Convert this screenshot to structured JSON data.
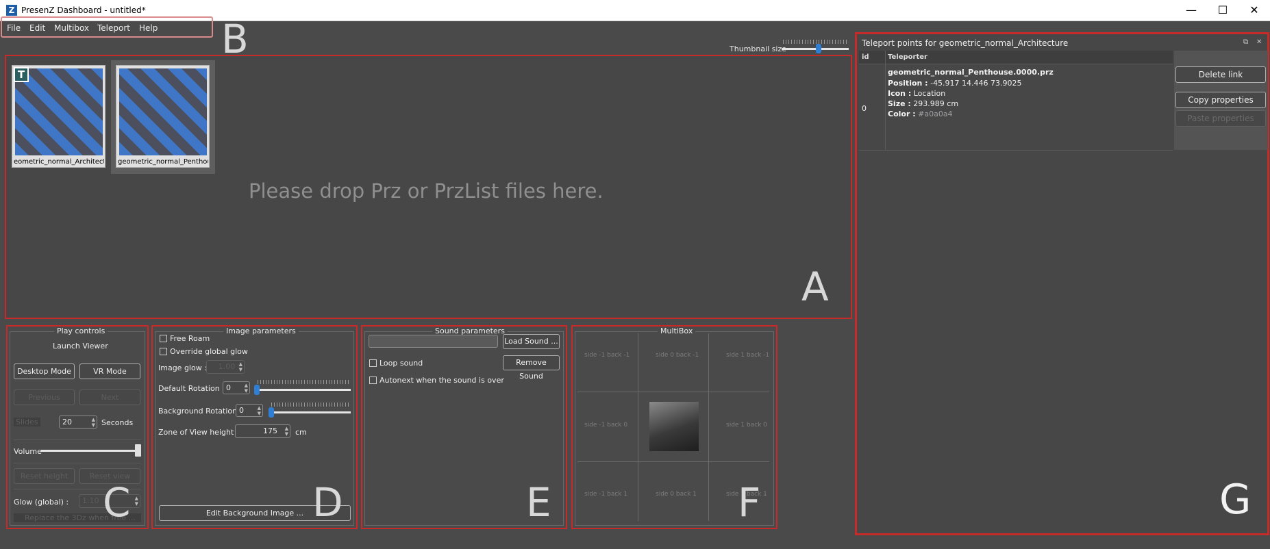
{
  "window": {
    "app_icon": "Z",
    "title": "PresenZ Dashboard - untitled*",
    "minimize": "—",
    "maximize": "☐",
    "close": "✕"
  },
  "menu": [
    "File",
    "Edit",
    "Multibox",
    "Teleport",
    "Help"
  ],
  "region_labels": {
    "a": "A",
    "b": "B",
    "c": "C",
    "d": "D",
    "e": "E",
    "f": "F",
    "g": "G"
  },
  "thumbnails": {
    "size_label": "Thumbnail size",
    "size_value": 0.55,
    "items": [
      {
        "badge": "T",
        "label": "eometric_normal_Architectur"
      },
      {
        "badge": "",
        "label": "geometric_normal_Penthouse"
      }
    ]
  },
  "drop_hint": "Please drop Prz or PrzList files here.",
  "play_controls": {
    "title": "Play controls",
    "launch_viewer": "Launch Viewer",
    "desktop_mode": "Desktop Mode",
    "vr_mode": "VR Mode",
    "previous": "Previous",
    "next": "Next",
    "slideshow": "Slides",
    "slideshow_seconds": "20",
    "seconds_label": "Seconds",
    "volume_label": "Volume",
    "volume_value": 1.0,
    "reset_height": "Reset height",
    "reset_view": "Reset view",
    "glow_label": "Glow (global) :",
    "glow_value": "1.10",
    "replace_label": "Replace the 3Dz when free ..."
  },
  "image_parameters": {
    "title": "Image parameters",
    "free_roam": "Free Roam",
    "override_glow": "Override global glow",
    "image_glow_label": "Image glow :",
    "image_glow_value": "1.00",
    "default_rotation_label": "Default Rotation :",
    "default_rotation_value": "0",
    "background_rotation_label": "Background Rotation :",
    "background_rotation_value": "0",
    "zov_label": "Zone of View height :",
    "zov_value": "175",
    "zov_unit": "cm",
    "edit_bg": "Edit Background Image ..."
  },
  "sound_parameters": {
    "title": "Sound parameters",
    "load_sound": "Load Sound ...",
    "remove_sound": "Remove Sound",
    "loop_sound": "Loop sound",
    "autonext": "Autonext when the sound is over"
  },
  "multibox": {
    "title": "MultiBox",
    "cells": [
      "side -1 back -1",
      "side 0 back -1",
      "side 1 back -1",
      "side -1 back 0",
      "",
      "side 1 back 0",
      "side -1 back 1",
      "side 0 back 1",
      "side 1 back 1"
    ]
  },
  "teleport": {
    "title": "Teleport points for geometric_normal_Architecture",
    "col_id": "id",
    "col_teleporter": "Teleporter",
    "rows": [
      {
        "id": "0",
        "file": "geometric_normal_Penthouse.0000.prz",
        "position_label": "Position :",
        "position": "-45.917 14.446 73.9025",
        "icon_label": "Icon :",
        "icon": "Location",
        "size_label": "Size :",
        "size": "293.989 cm",
        "color_label": "Color :",
        "color": "#a0a0a4"
      }
    ],
    "delete_link": "Delete link",
    "copy_properties": "Copy properties",
    "paste_properties": "Paste properties",
    "float_icon": "⧉",
    "close_icon": "✕"
  }
}
